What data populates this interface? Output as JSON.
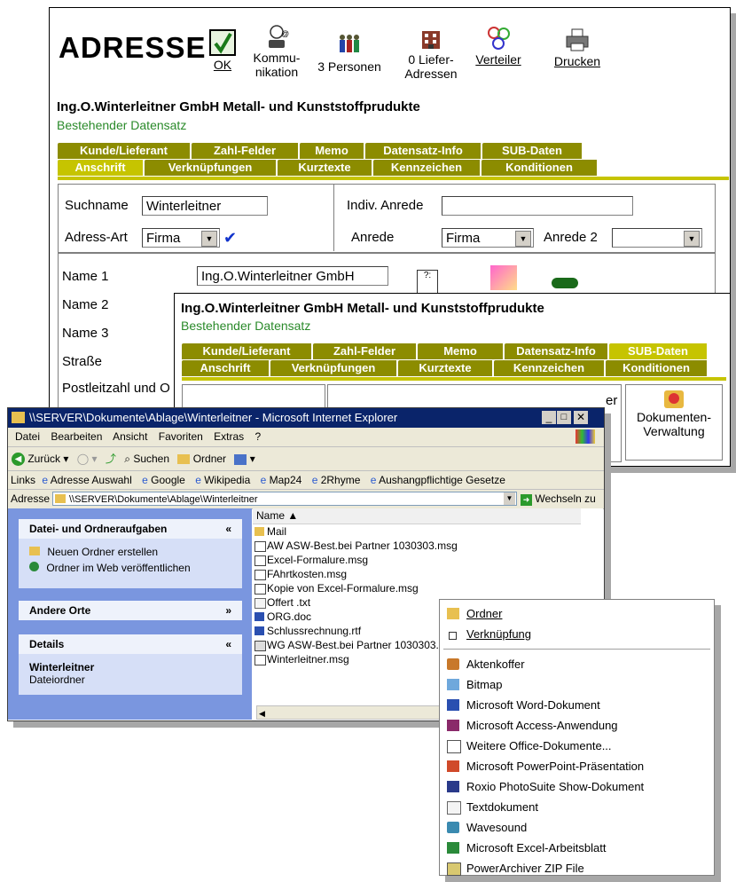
{
  "main_window": {
    "title": "ADRESSE",
    "toolbar": [
      {
        "label": "OK",
        "icon": "checkmark-icon"
      },
      {
        "label": "Kommu- nikation",
        "icon": "phone-icon"
      },
      {
        "label": "3 Personen",
        "icon": "people-icon"
      },
      {
        "label": "0 Liefer- Adressen",
        "icon": "building-icon"
      },
      {
        "label": "Verteiler",
        "icon": "distribution-icon"
      },
      {
        "label": "Drucken",
        "icon": "printer-icon"
      }
    ],
    "company": "Ing.O.Winterleitner GmbH Metall- und Kunststoffprudukte",
    "record_status": "Bestehender Datensatz",
    "tabs_row1": [
      "Kunde/Lieferant",
      "Zahl-Felder",
      "Memo",
      "Datensatz-Info",
      "SUB-Daten"
    ],
    "tabs_row2": [
      "Anschrift",
      "Verknüpfungen",
      "Kurztexte",
      "Kennzeichen",
      "Konditionen"
    ],
    "form": {
      "suchname_label": "Suchname",
      "suchname_value": "Winterleitner",
      "indiv_label": "Indiv. Anrede",
      "indiv_value": "",
      "adressart_label": "Adress-Art",
      "adressart_value": "Firma",
      "anrede_label": "Anrede",
      "anrede_value": "Firma",
      "anrede2_label": "Anrede 2",
      "anrede2_value": "",
      "name1_label": "Name 1",
      "name1_value": "Ing.O.Winterleitner GmbH",
      "name2_label": "Name 2",
      "name3_label": "Name 3",
      "strasse_label": "Straße",
      "plz_label": "Postleitzahl und O"
    }
  },
  "sub_window": {
    "company": "Ing.O.Winterleitner GmbH Metall- und Kunststoffprudukte",
    "record_status": "Bestehender Datensatz",
    "tabs_row1": [
      "Kunde/Lieferant",
      "Zahl-Felder",
      "Memo",
      "Datensatz-Info",
      "SUB-Daten"
    ],
    "tabs_row2": [
      "Anschrift",
      "Verknüpfungen",
      "Kurztexte",
      "Kennzeichen",
      "Konditionen"
    ],
    "doc_button": "Dokumenten- Verwaltung",
    "partial_text": "er"
  },
  "explorer": {
    "title": "\\\\SERVER\\Dokumente\\Ablage\\Winterleitner - Microsoft Internet Explorer",
    "menu": [
      "Datei",
      "Bearbeiten",
      "Ansicht",
      "Favoriten",
      "Extras",
      "?"
    ],
    "toolbar": {
      "back": "Zurück",
      "search": "Suchen",
      "folders": "Ordner"
    },
    "links_label": "Links",
    "links": [
      "Adresse Auswahl",
      "Google",
      "Wikipedia",
      "Map24",
      "2Rhyme",
      "Aushangpflichtige Gesetze"
    ],
    "address_label": "Adresse",
    "address_value": "\\\\SERVER\\Dokumente\\Ablage\\Winterleitner",
    "go_label": "Wechseln zu",
    "tasks_title": "Datei- und Ordneraufgaben",
    "tasks": [
      "Neuen Ordner erstellen",
      "Ordner im Web veröffentlichen"
    ],
    "other_places": "Andere Orte",
    "details_title": "Details",
    "details_name": "Winterleitner",
    "details_type": "Dateiordner",
    "column_name": "Name",
    "files": [
      "Mail",
      "AW ASW-Best.bei Partner  1030303.msg",
      "Excel-Formalure.msg",
      "FAhrtkosten.msg",
      "Kopie von Excel-Formalure.msg",
      "Offert .txt",
      "ORG.doc",
      "Schlussrechnung.rtf",
      "WG ASW-Best.bei Partner  1030303.",
      "Winterleitner.msg"
    ]
  },
  "context_menu": {
    "items": [
      "Ordner",
      "Verknüpfung",
      "Aktenkoffer",
      "Bitmap",
      "Microsoft Word-Dokument",
      "Microsoft Access-Anwendung",
      "Weitere Office-Dokumente...",
      "Microsoft PowerPoint-Präsentation",
      "Roxio PhotoSuite Show-Dokument",
      "Textdokument",
      "Wavesound",
      "Microsoft Excel-Arbeitsblatt",
      "PowerArchiver ZIP File"
    ]
  },
  "colors": {
    "tab_dark": "#8c8c00",
    "tab_active": "#c6c400",
    "green_text": "#2a8a2a",
    "ie_title": "#0a246a"
  }
}
